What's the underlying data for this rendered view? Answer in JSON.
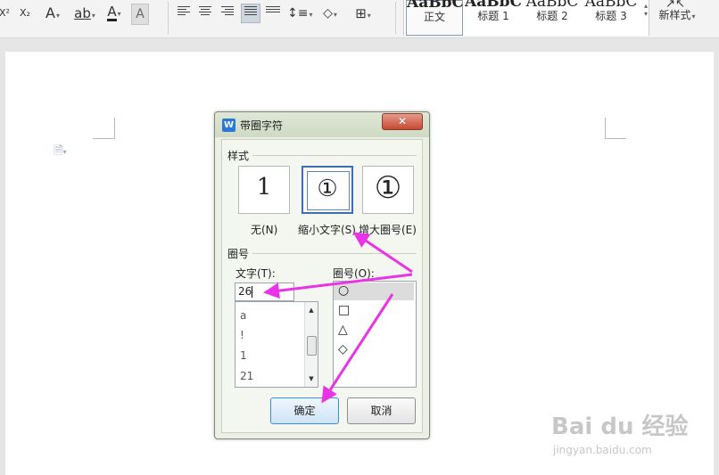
{
  "toolbar": {
    "superscript": "X²",
    "subscript": "X₂",
    "font_effects": "A",
    "strikethrough": "ab",
    "font_color": "A",
    "char_shading": "A",
    "styles": [
      {
        "preview": "AaBbC",
        "name": "正文"
      },
      {
        "preview": "AaBbC",
        "name": "标题 1"
      },
      {
        "preview": "AaBbC",
        "name": "标题 2"
      },
      {
        "preview": "AaBbC",
        "name": "标题 3"
      }
    ],
    "new_style": "新样式"
  },
  "dialog": {
    "title": "带圈字符",
    "close_label": "✕",
    "style_group": "样式",
    "style_options": [
      {
        "glyph": "1",
        "label": "无(N)"
      },
      {
        "glyph": "①",
        "label": "缩小文字(S)"
      },
      {
        "glyph": "①",
        "label": "增大圈号(E)"
      }
    ],
    "selected_style": "缩小文字(S)",
    "enclosure_group": "圈号",
    "text_label": "文字(T):",
    "text_value": "26",
    "text_list": [
      "a",
      "!",
      "1",
      "21"
    ],
    "shape_label": "圈号(O):",
    "shapes": [
      "○",
      "□",
      "△",
      "◇"
    ],
    "selected_shape": "○",
    "ok_label": "确定",
    "cancel_label": "取消"
  },
  "watermark": {
    "brand": "Bai du 经验",
    "url": "jingyan.baidu.com"
  },
  "colors": {
    "arrow": "#e933e6",
    "selected_border": "#3a6fb6",
    "close_button": "#c64a32"
  }
}
